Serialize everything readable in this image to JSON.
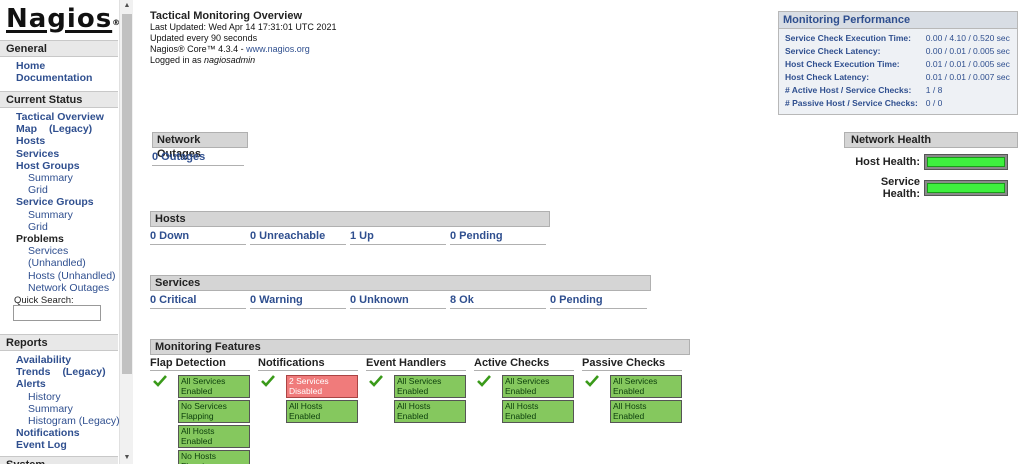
{
  "logo": {
    "text": "Nagios",
    "mark": "®"
  },
  "sidebar": {
    "general": {
      "heading": "General",
      "items": [
        "Home",
        "Documentation"
      ]
    },
    "current_status": {
      "heading": "Current Status",
      "tactical": "Tactical Overview",
      "map": "Map",
      "map_legacy": "(Legacy)",
      "hosts": "Hosts",
      "services": "Services",
      "host_groups": "Host Groups",
      "host_groups_summary": "Summary",
      "host_groups_grid": "Grid",
      "service_groups": "Service Groups",
      "service_groups_summary": "Summary",
      "service_groups_grid": "Grid",
      "problems": "Problems",
      "problems_services": "Services",
      "problems_unhandled": "(Unhandled)",
      "problems_hosts": "Hosts (Unhandled)",
      "problems_outages": "Network Outages",
      "quick_search_label": "Quick Search:",
      "quick_search_value": ""
    },
    "reports": {
      "heading": "Reports",
      "availability": "Availability",
      "trends": "Trends",
      "trends_legacy": "(Legacy)",
      "alerts": "Alerts",
      "history": "History",
      "summary": "Summary",
      "histogram": "Histogram (Legacy)",
      "notifications": "Notifications",
      "event_log": "Event Log"
    },
    "system": {
      "heading": "System"
    }
  },
  "overview": {
    "title": "Tactical Monitoring Overview",
    "last_updated": "Last Updated: Wed Apr 14 17:31:01 UTC 2021",
    "update_interval": "Updated every 90 seconds",
    "version_prefix": "Nagios® Core™ 4.3.4 - ",
    "version_link": "www.nagios.org",
    "logged_in_prefix": "Logged in as ",
    "user": "nagiosadmin"
  },
  "outages": {
    "heading": "Network Outages",
    "value": "0 Outages"
  },
  "hosts": {
    "heading": "Hosts",
    "cells": [
      "0 Down",
      "0 Unreachable",
      "1 Up",
      "0 Pending"
    ]
  },
  "services": {
    "heading": "Services",
    "cells": [
      "0 Critical",
      "0 Warning",
      "0 Unknown",
      "8 Ok",
      "0 Pending"
    ]
  },
  "features": {
    "heading": "Monitoring Features",
    "columns": [
      {
        "title": "Flap Detection",
        "badges": [
          "All Services Enabled",
          "No Services Flapping",
          "All Hosts Enabled",
          "No Hosts Flapping"
        ]
      },
      {
        "title": "Notifications",
        "badges": [
          "2 Services Disabled",
          "All Hosts Enabled"
        ]
      },
      {
        "title": "Event Handlers",
        "badges": [
          "All Services Enabled",
          "All Hosts Enabled"
        ]
      },
      {
        "title": "Active Checks",
        "badges": [
          "All Services Enabled",
          "All Hosts Enabled"
        ]
      },
      {
        "title": "Passive Checks",
        "badges": [
          "All Services Enabled",
          "All Hosts Enabled"
        ]
      }
    ]
  },
  "performance": {
    "heading": "Monitoring Performance",
    "rows": [
      {
        "label": "Service Check Execution Time:",
        "value": "0.00 / 4.10 / 0.520 sec"
      },
      {
        "label": "Service Check Latency:",
        "value": "0.00 / 0.01 / 0.005 sec"
      },
      {
        "label": "Host Check Execution Time:",
        "value": "0.01 / 0.01 / 0.005 sec"
      },
      {
        "label": "Host Check Latency:",
        "value": "0.01 / 0.01 / 0.007 sec"
      },
      {
        "label": "# Active Host / Service Checks:",
        "value": "1 / 8"
      },
      {
        "label": "# Passive Host / Service Checks:",
        "value": "0 / 0"
      }
    ]
  },
  "health": {
    "heading": "Network Health",
    "host_label": "Host Health:",
    "service_label": "Service Health:",
    "host_level": 1.0,
    "service_level": 1.0
  },
  "colors": {
    "link": "#2f4f8f",
    "ok": "#85c85e",
    "problem": "#f07b7b",
    "health_fill": "#3ef03e"
  }
}
